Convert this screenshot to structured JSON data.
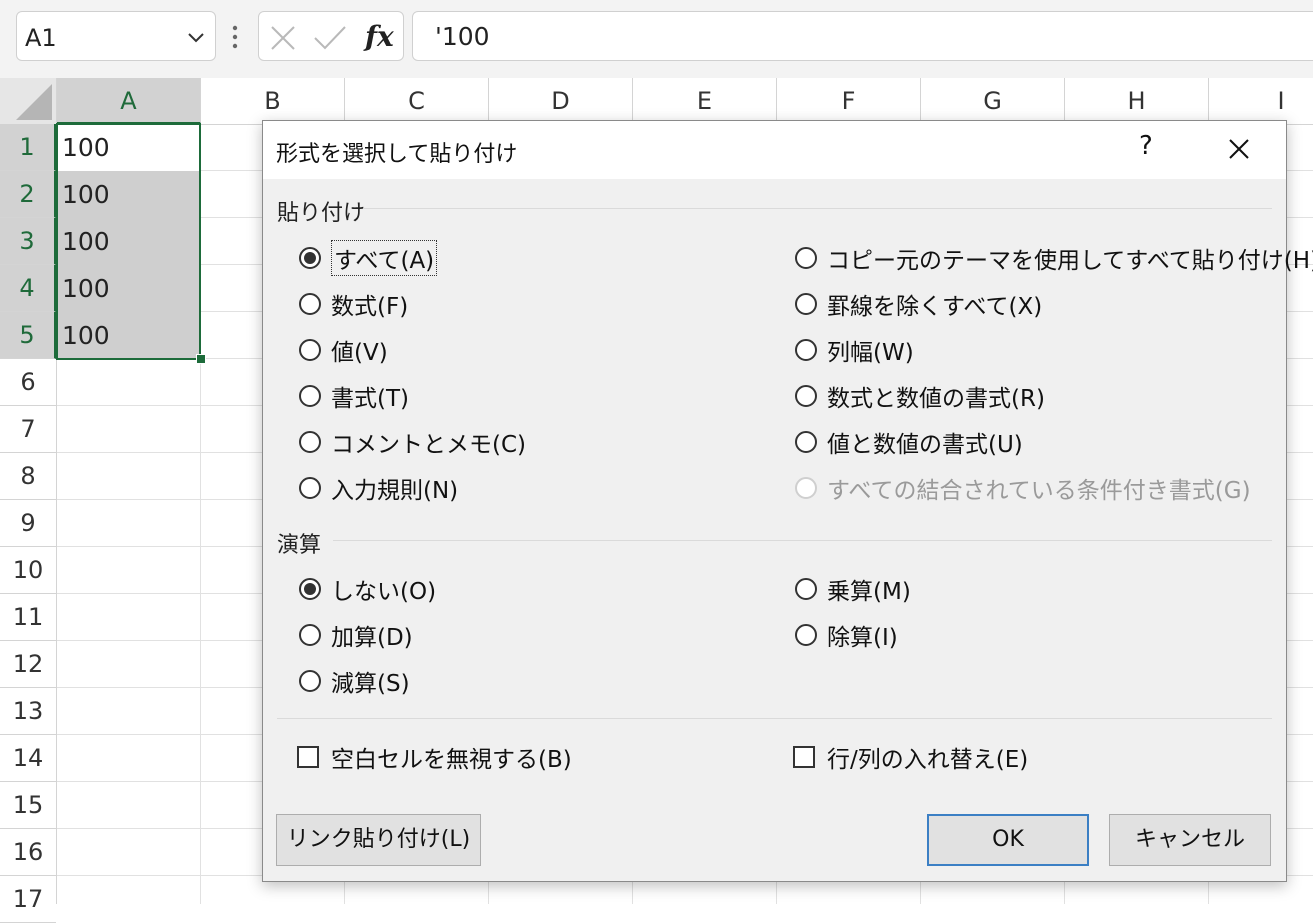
{
  "formula_bar": {
    "name_box": "A1",
    "formula": "'100",
    "fx_label": "fx"
  },
  "columns": [
    "A",
    "B",
    "C",
    "D",
    "E",
    "F",
    "G",
    "H",
    "I"
  ],
  "rows": [
    "1",
    "2",
    "3",
    "4",
    "5",
    "6",
    "7",
    "8",
    "9",
    "10",
    "11",
    "12",
    "13",
    "14",
    "15",
    "16",
    "17"
  ],
  "cells": {
    "A1": "100",
    "A2": "100",
    "A3": "100",
    "A4": "100",
    "A5": "100"
  },
  "dialog": {
    "title": "形式を選択して貼り付け",
    "help": "?",
    "paste_section": "貼り付け",
    "paste_options_left": [
      "すべて(A)",
      "数式(F)",
      "値(V)",
      "書式(T)",
      "コメントとメモ(C)",
      "入力規則(N)"
    ],
    "paste_options_right": [
      "コピー元のテーマを使用してすべて貼り付け(H)",
      "罫線を除くすべて(X)",
      "列幅(W)",
      "数式と数値の書式(R)",
      "値と数値の書式(U)",
      "すべての結合されている条件付き書式(G)"
    ],
    "operation_section": "演算",
    "operation_left": [
      "しない(O)",
      "加算(D)",
      "減算(S)"
    ],
    "operation_right": [
      "乗算(M)",
      "除算(I)"
    ],
    "skip_blanks": "空白セルを無視する(B)",
    "transpose": "行/列の入れ替え(E)",
    "paste_link_button": "リンク貼り付け(L)",
    "ok_button": "OK",
    "cancel_button": "キャンセル"
  }
}
